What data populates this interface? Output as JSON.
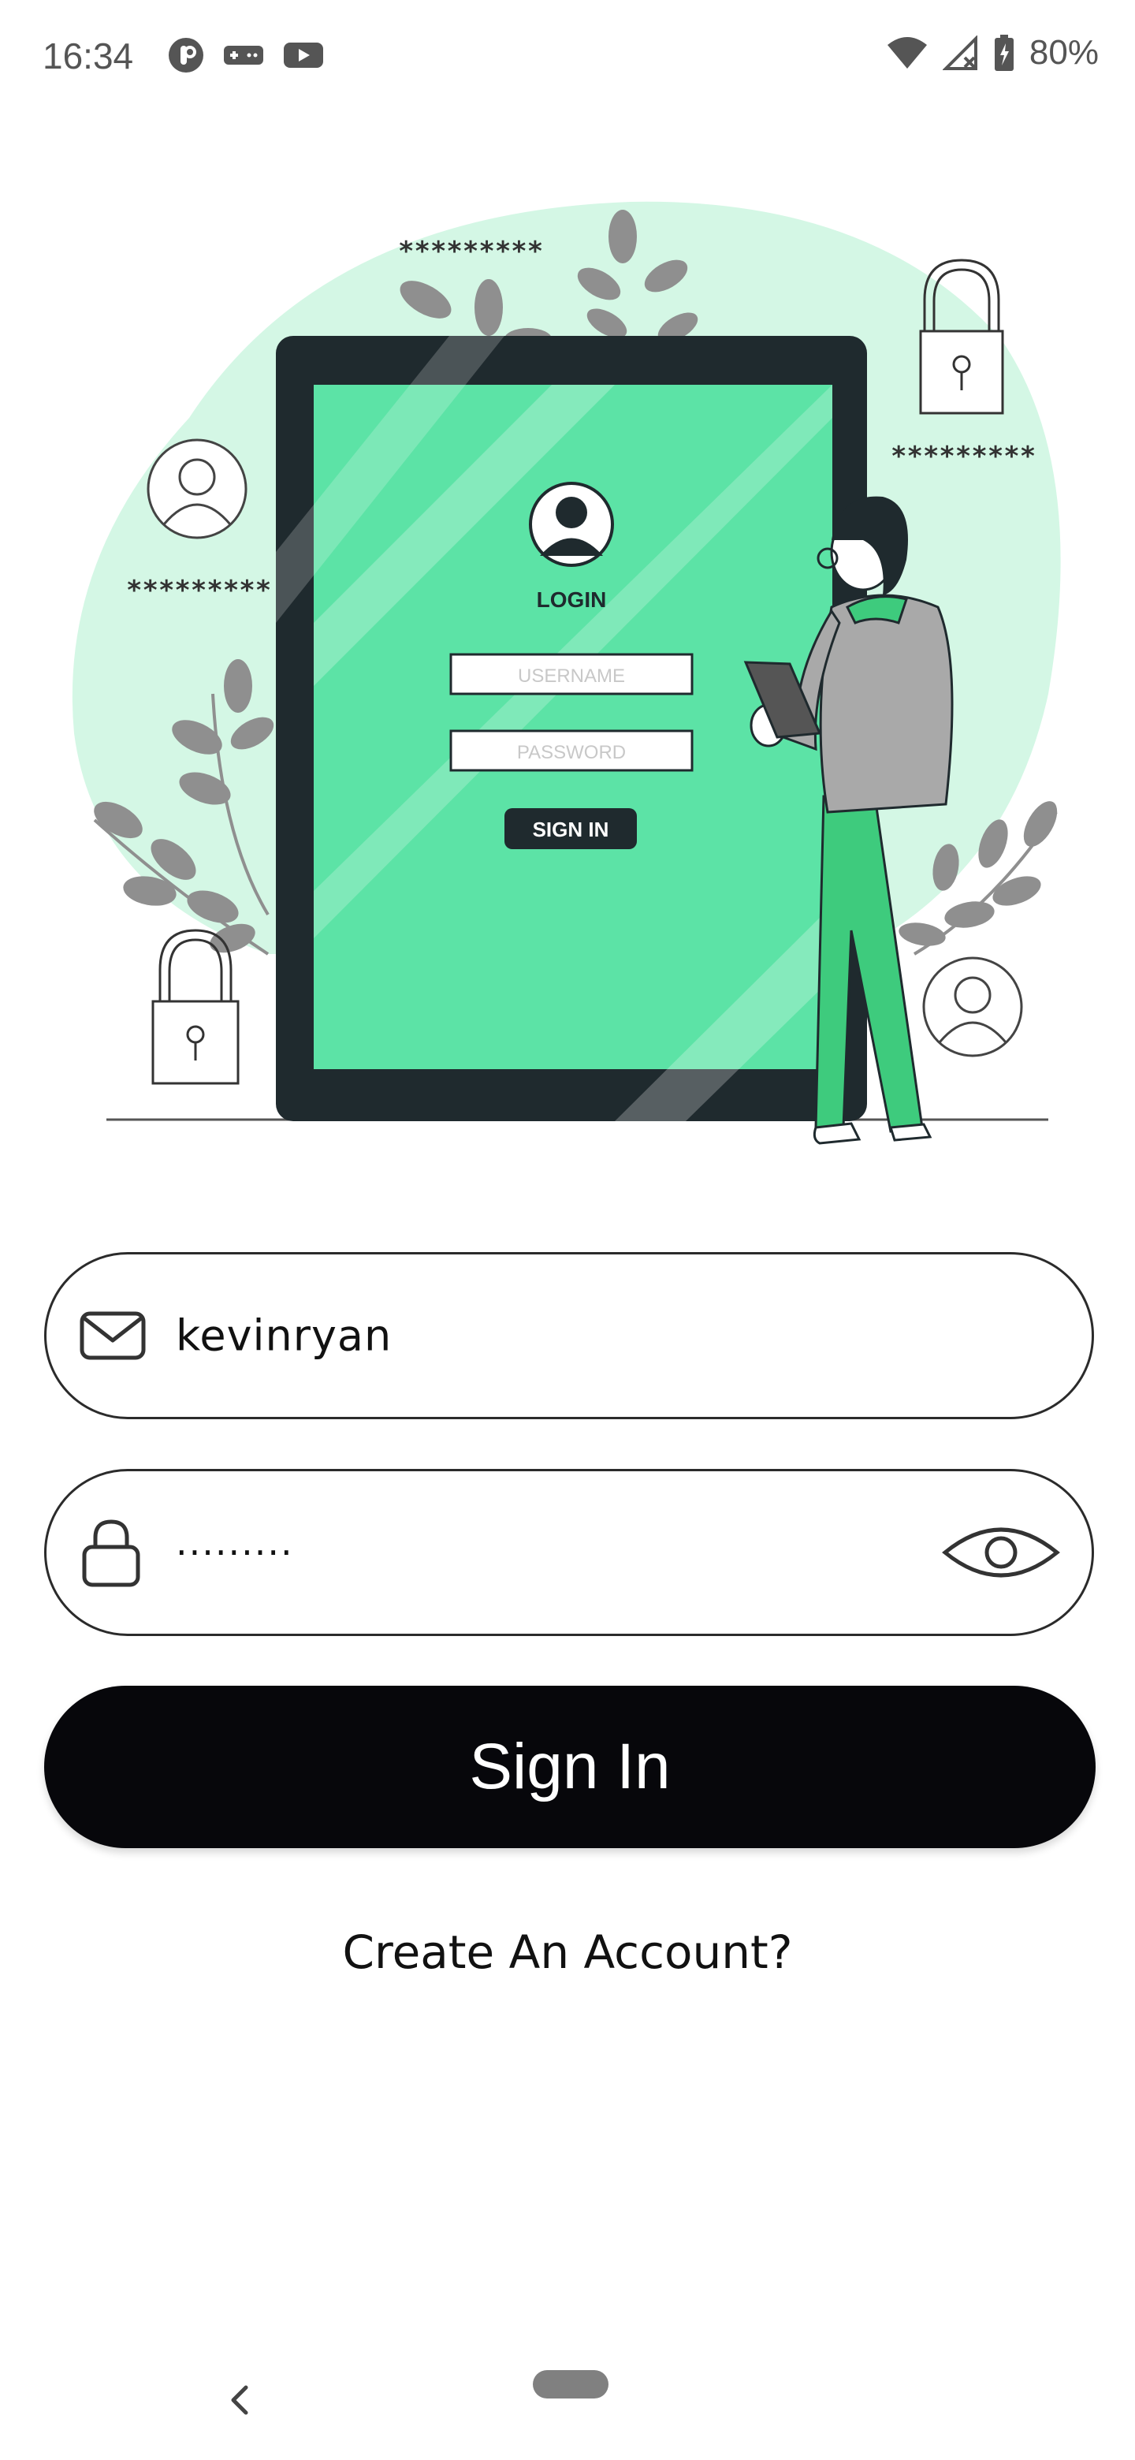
{
  "status_bar": {
    "time": "16:34",
    "battery_percent": "80%",
    "icons": [
      "app-notification-icon",
      "game-icon",
      "youtube-icon",
      "wifi-icon",
      "signal-icon",
      "battery-charging-icon"
    ]
  },
  "illustration": {
    "card_title": "LOGIN",
    "card_username_placeholder": "USERNAME",
    "card_password_placeholder": "PASSWORD",
    "card_button_label": "SIGN IN",
    "masked_text_1": "*********",
    "masked_text_2": "*********",
    "masked_text_3": "*********",
    "colors": {
      "accent_green": "#5ce3a6",
      "bg_circle": "#d4f7e5",
      "frame": "#1f2a2e"
    }
  },
  "form": {
    "username": {
      "value": "kevinryan",
      "icon": "mail-icon"
    },
    "password": {
      "value": "·········",
      "icon": "lock-icon",
      "toggle_icon": "eye-icon"
    },
    "submit_label": "Sign In",
    "create_account_label": "Create An Account?"
  },
  "nav": {
    "back_icon": "chevron-left-icon",
    "home_icon": "home-pill"
  }
}
